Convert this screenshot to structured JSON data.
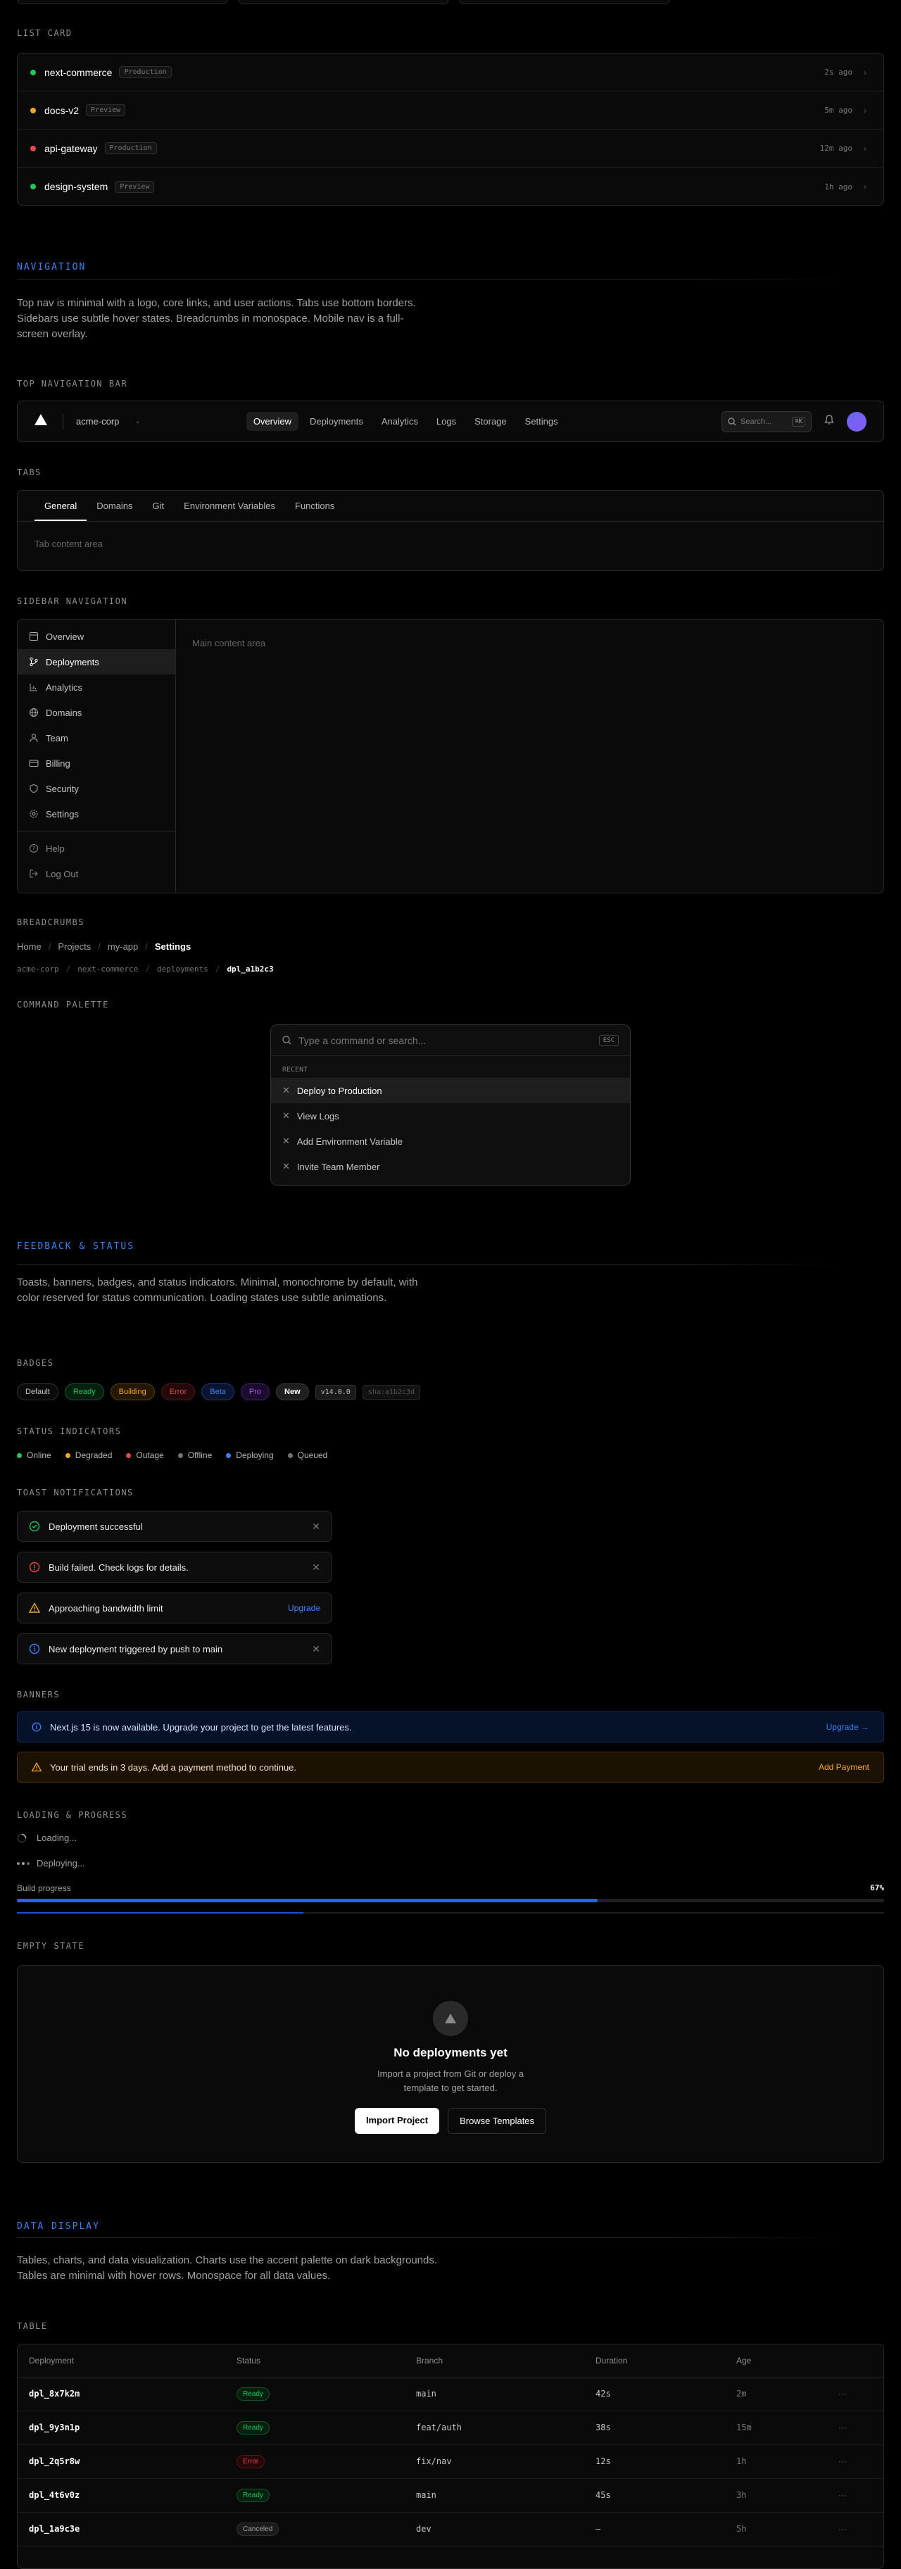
{
  "list_card": {
    "label": "LIST CARD",
    "items": [
      {
        "name": "next-commerce",
        "env": "Production",
        "time": "2s ago",
        "color": "#22c55e"
      },
      {
        "name": "docs-v2",
        "env": "Preview",
        "time": "5m ago",
        "color": "#f5a524"
      },
      {
        "name": "api-gateway",
        "env": "Production",
        "time": "12m ago",
        "color": "#e5484d"
      },
      {
        "name": "design-system",
        "env": "Preview",
        "time": "1h ago",
        "color": "#22c55e"
      }
    ]
  },
  "navigation": {
    "title": "NAVIGATION",
    "desc": "Top nav is minimal with a logo, core links, and user actions. Tabs use bottom borders. Sidebars use subtle hover states. Breadcrumbs in monospace. Mobile nav is a full-screen overlay."
  },
  "topnav": {
    "label": "TOP NAVIGATION BAR",
    "team": "acme-corp",
    "links": [
      "Overview",
      "Deployments",
      "Analytics",
      "Logs",
      "Storage",
      "Settings"
    ],
    "search_placeholder": "Search...",
    "search_kbd": "⌘K"
  },
  "tabs": {
    "label": "TABS",
    "items": [
      "General",
      "Domains",
      "Git",
      "Environment Variables",
      "Functions"
    ],
    "content": "Tab content area"
  },
  "sidebar": {
    "label": "SIDEBAR NAVIGATION",
    "items": [
      "Overview",
      "Deployments",
      "Analytics",
      "Domains",
      "Team",
      "Billing",
      "Security",
      "Settings"
    ],
    "help": "Help",
    "logout": "Log Out",
    "main": "Main content area"
  },
  "breadcrumbs": {
    "label": "BREADCRUMBS",
    "primary": [
      "Home",
      "Projects",
      "my-app",
      "Settings"
    ],
    "mono": [
      "acme-corp",
      "next-commerce",
      "deployments",
      "dpl_a1b2c3"
    ]
  },
  "palette": {
    "label": "COMMAND PALETTE",
    "placeholder": "Type a command or search...",
    "esc": "ESC",
    "recent": "RECENT",
    "items": [
      "Deploy to Production",
      "View Logs",
      "Add Environment Variable",
      "Invite Team Member"
    ]
  },
  "feedback": {
    "title": "FEEDBACK & STATUS",
    "desc": "Toasts, banners, badges, and status indicators. Minimal, monochrome by default, with color reserved for status communication. Loading states use subtle animations."
  },
  "badges": {
    "label": "BADGES",
    "items": [
      {
        "text": "Default",
        "color": "#c7c7c7",
        "bg": "#0a0a0a",
        "border": "#333333"
      },
      {
        "text": "Ready",
        "color": "#22c55e",
        "bg": "#06200f",
        "border": "#14532d"
      },
      {
        "text": "Building",
        "color": "#f5a524",
        "bg": "#241804",
        "border": "#5c3d0a"
      },
      {
        "text": "Error",
        "color": "#e5484d",
        "bg": "#24080a",
        "border": "#5c1418"
      },
      {
        "text": "Beta",
        "color": "#3b82f6",
        "bg": "#0a1430",
        "border": "#1e3a70"
      },
      {
        "text": "Pro",
        "color": "#a855f7",
        "bg": "#1c0c2e",
        "border": "#45206b"
      },
      {
        "text": "New",
        "color": "#ffffff",
        "bg": "#1f1f1f",
        "border": "#3a3a3a"
      }
    ],
    "mono": [
      "v14.0.0",
      "sha:a1b2c3d"
    ]
  },
  "status": {
    "label": "STATUS INDICATORS",
    "items": [
      {
        "text": "Online",
        "color": "#22c55e"
      },
      {
        "text": "Degraded",
        "color": "#f5a524"
      },
      {
        "text": "Outage",
        "color": "#e5484d"
      },
      {
        "text": "Offline",
        "color": "#737373"
      },
      {
        "text": "Deploying",
        "color": "#3b82f6"
      },
      {
        "text": "Queued",
        "color": "#737373"
      }
    ]
  },
  "toasts": {
    "label": "TOAST NOTIFICATIONS",
    "success": "Deployment successful",
    "error": "Build failed. Check logs for details.",
    "warning": "Approaching bandwidth limit",
    "warning_action": "Upgrade",
    "info": "New deployment triggered by push to main"
  },
  "banners": {
    "label": "BANNERS",
    "info": "Next.js 15 is now available. Upgrade your project to get the latest features.",
    "info_action": "Upgrade →",
    "warning": "Your trial ends in 3 days. Add a payment method to continue.",
    "warning_action": "Add Payment"
  },
  "loading": {
    "label": "LOADING & PROGRESS",
    "spinner": "Loading...",
    "dots": "Deploying...",
    "progress_label": "Build progress",
    "progress_value": "67%",
    "progress": 0.67,
    "secondary_progress": 0.33
  },
  "empty": {
    "label": "EMPTY STATE",
    "title": "No deployments yet",
    "desc": "Import a project from Git or deploy a template to get started.",
    "primary": "Import Project",
    "secondary": "Browse Templates"
  },
  "data_display": {
    "title": "DATA DISPLAY",
    "desc": "Tables, charts, and data visualization. Charts use the accent palette on dark backgrounds. Tables are minimal with hover rows. Monospace for all data values."
  },
  "table": {
    "label": "TABLE",
    "headers": [
      "Deployment",
      "Status",
      "Branch",
      "Duration",
      "Age"
    ],
    "rows": [
      {
        "id": "dpl_8x7k2m",
        "status": "Ready",
        "branch": "main",
        "duration": "42s",
        "age": "2m"
      },
      {
        "id": "dpl_9y3n1p",
        "status": "Ready",
        "branch": "feat/auth",
        "duration": "38s",
        "age": "15m"
      },
      {
        "id": "dpl_2q5r8w",
        "status": "Error",
        "branch": "fix/nav",
        "duration": "12s",
        "age": "1h"
      },
      {
        "id": "dpl_4t6v0z",
        "status": "Ready",
        "branch": "main",
        "duration": "45s",
        "age": "3h"
      },
      {
        "id": "dpl_1a9c3e",
        "status": "Canceled",
        "branch": "dev",
        "duration": "—",
        "age": "5h"
      }
    ]
  }
}
